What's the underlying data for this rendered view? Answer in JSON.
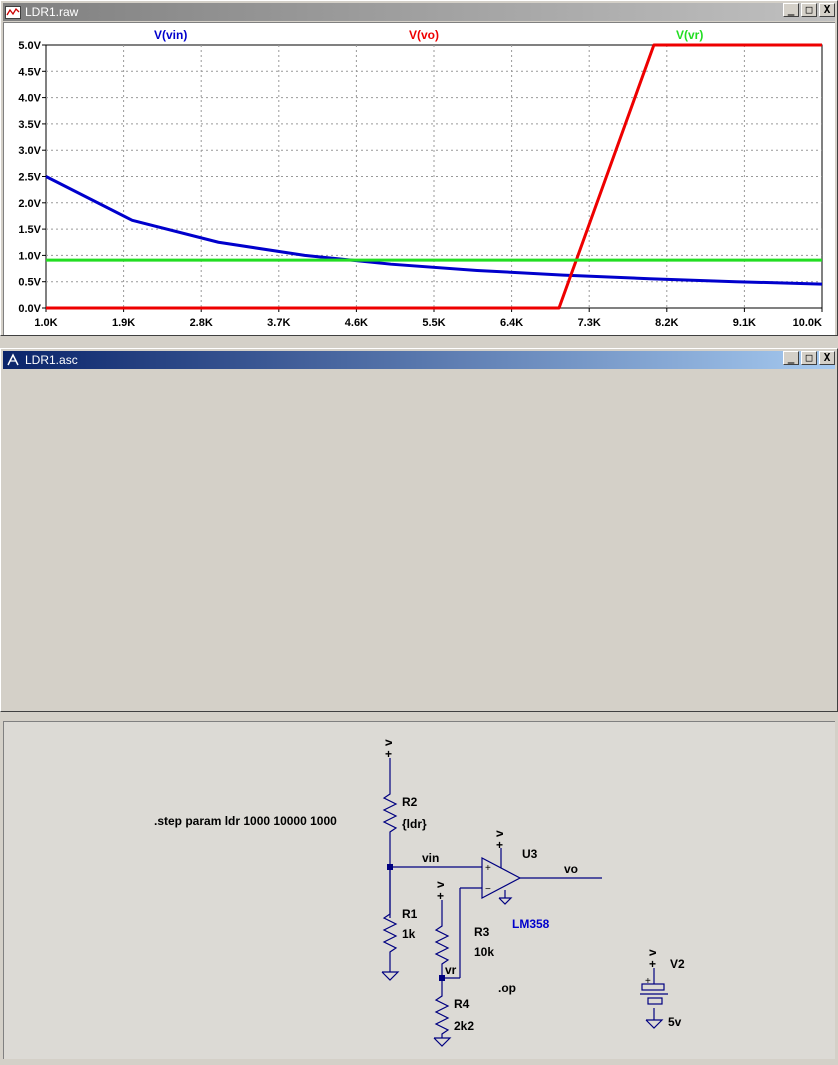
{
  "plot_window": {
    "title": "LDR1.raw",
    "buttons": [
      "_",
      "□",
      "X"
    ]
  },
  "schematic_window": {
    "title": "LDR1.asc",
    "buttons": [
      "_",
      "□",
      "X"
    ]
  },
  "chart_data": {
    "type": "line",
    "x": [
      1000,
      1900,
      2800,
      3700,
      4600,
      5500,
      6400,
      7300,
      8200,
      9100,
      10000
    ],
    "x_tick_labels": [
      "1.0K",
      "1.9K",
      "2.8K",
      "3.7K",
      "4.6K",
      "5.5K",
      "6.4K",
      "7.3K",
      "8.2K",
      "9.1K",
      "10.0K"
    ],
    "y_tick_labels": [
      "5.0V",
      "4.5V",
      "4.0V",
      "3.5V",
      "3.0V",
      "2.5V",
      "2.0V",
      "1.5V",
      "1.0V",
      "0.5V",
      "0.0V"
    ],
    "xlim": [
      1000,
      10000
    ],
    "ylim": [
      0,
      5
    ],
    "grid": true,
    "series": [
      {
        "name": "V(vin)",
        "color": "#0000cc",
        "x": [
          1000,
          2000,
          3000,
          4000,
          5000,
          6000,
          7000,
          8000,
          9000,
          10000
        ],
        "values": [
          2.5,
          1.667,
          1.25,
          1.0,
          0.833,
          0.714,
          0.625,
          0.556,
          0.5,
          0.455
        ]
      },
      {
        "name": "V(vo)",
        "color": "#ee0000",
        "x": [
          1000,
          6950,
          8050,
          10000
        ],
        "values": [
          0.0,
          0.0,
          5.0,
          5.0
        ]
      },
      {
        "name": "V(vr)",
        "color": "#22dd22",
        "x": [
          1000,
          10000
        ],
        "values": [
          0.909,
          0.909
        ]
      }
    ]
  },
  "schematic": {
    "directive": ".step param ldr 1000 10000 1000",
    "op_directive": ".op",
    "supply_plus": "+",
    "supply_v": "v",
    "components": {
      "r2": {
        "ref": "R2",
        "value": "{ldr}"
      },
      "r1": {
        "ref": "R1",
        "value": "1k"
      },
      "r3": {
        "ref": "R3",
        "value": "10k"
      },
      "r4": {
        "ref": "R4",
        "value": "2k2"
      },
      "u3": {
        "ref": "U3",
        "value": "LM358"
      },
      "v2": {
        "ref": "V2",
        "value": "5v"
      }
    },
    "nets": {
      "vin": "vin",
      "vo": "vo",
      "vr": "vr"
    },
    "opamp_plus": "+",
    "opamp_minus": "−"
  }
}
